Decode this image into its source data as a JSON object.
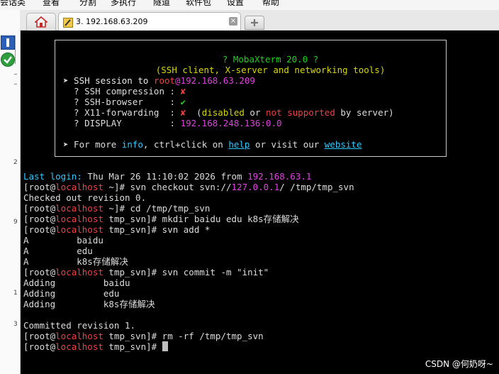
{
  "menubar": {
    "items": [
      "会话类",
      "查看",
      "分割",
      "多执行",
      "隧道",
      "软件包",
      "设置",
      "帮助"
    ]
  },
  "tabs": {
    "session_label": "3. 192.168.63.209",
    "close_label": "×"
  },
  "sidebar": {
    "digits": [
      "2",
      "9",
      "1",
      "3"
    ]
  },
  "banner": {
    "title_line": "? MobaXterm 20.0 ?",
    "subtitle_line": "(SSH client, X-server and networking tools)",
    "session_prefix": "➤ SSH session to ",
    "session_user": "root",
    "session_at_host": "@192.168.63.209",
    "compression_label": "  ? SSH compression : ",
    "compression_value": "✘",
    "browser_label": "  ? SSH-browser     : ",
    "browser_value": "✔",
    "x11_label": "  ? X11-forwarding  : ",
    "x11_value": "✘",
    "x11_note_open": "  (",
    "x11_disabled": "disabled",
    "x11_or": " or ",
    "x11_not_supported": "not supported",
    "x11_by_server": " by server)",
    "display_label": "  ? DISPLAY         : ",
    "display_value": "192.168.248.136:0.0",
    "more_prefix": "➤ For more ",
    "more_info": "info",
    "more_mid": ", ctrl+click on ",
    "more_help": "help",
    "more_or_visit": " or visit our ",
    "more_website": "website"
  },
  "terminal": {
    "last_login_label": "Last login:",
    "last_login_text": " Thu Mar 26 11:10:02 2026 from ",
    "last_login_ip": "192.168.63.1",
    "prompt_open": "[root@",
    "prompt_host": "localhost",
    "lines": {
      "l1_rest": " ~]# svn checkout svn://",
      "l1_ip": "127.0.0.1",
      "l1_tail": "/ /tmp/tmp_svn",
      "l2": "Checked out revision 0.",
      "l3_rest": " ~]# cd /tmp/tmp_svn",
      "l4_rest": " tmp_svn]# mkdir baidu edu k8s存储解决",
      "l5_rest": " tmp_svn]# svn add *",
      "l6": "A         baidu",
      "l7": "A         edu",
      "l8": "A         k8s存储解决",
      "l9_rest": " tmp_svn]# svn commit -m \"init\"",
      "l10": "Adding         baidu",
      "l11": "Adding         edu",
      "l12": "Adding         k8s存储解决",
      "l13": "Committed revision 1.",
      "l14_rest": " tmp_svn]# rm -rf /tmp/tmp_svn",
      "l15_rest": " tmp_svn]# "
    }
  },
  "watermark": "CSDN @何奶呀~",
  "colors": {
    "terminal_bg": "#000000",
    "green": "#19d319",
    "magenta": "#e040e0",
    "red": "#f04040",
    "cyan": "#2cc8ff",
    "yellow": "#d7d700"
  }
}
